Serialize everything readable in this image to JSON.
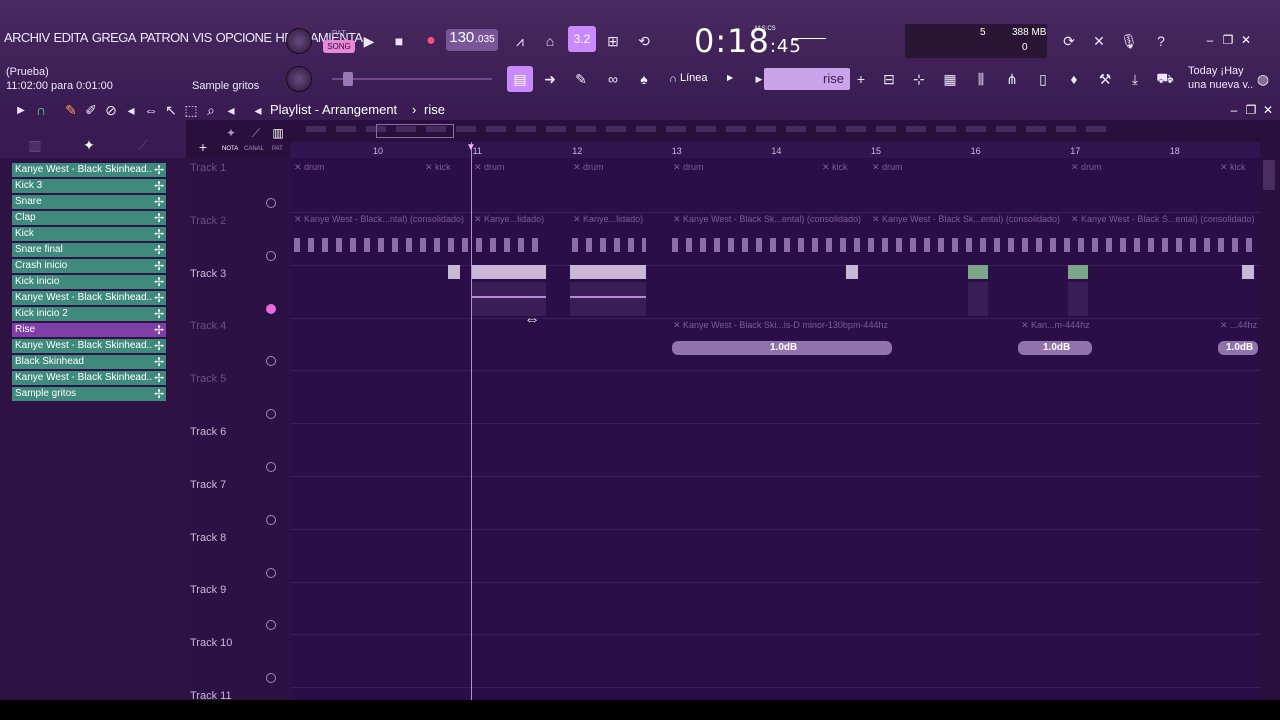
{
  "menu": [
    "ARCHIV",
    "EDITA",
    "GREGA",
    "PATRON",
    "VIS",
    "OPCIONE",
    "HERRAMIENTA"
  ],
  "hint": {
    "title": "(Prueba)",
    "line": "11:02:00 para 0:01:00",
    "sample": "Sample gritos"
  },
  "transport": {
    "pat": "PAT",
    "song": "SONG",
    "tempo_main": "130",
    "tempo_frac": ".035",
    "time_main": "0:18",
    "time_cs": ":45",
    "time_unit": "M:S:CS",
    "step": "3.2"
  },
  "monitor": {
    "mb": "388 MB",
    "cpu": "5",
    "poly": "0"
  },
  "snap_mode": "Línea",
  "pattern_selector": "rise",
  "news": {
    "line1": "Today  ¡Hay",
    "line2": "una nueva v.."
  },
  "playlist": {
    "title": "Playlist - Arrangement",
    "arrow": "›",
    "pattern": "rise"
  },
  "picker_tabs": [
    "NOTA",
    "CANAL",
    "PAT"
  ],
  "picker_items": [
    {
      "label": "Kanye West - Black Skinhead..",
      "kind": "audio"
    },
    {
      "label": "Kick 3",
      "kind": "audio"
    },
    {
      "label": "Snare",
      "kind": "audio"
    },
    {
      "label": "Clap",
      "kind": "audio"
    },
    {
      "label": "Kick",
      "kind": "audio"
    },
    {
      "label": "Snare final",
      "kind": "audio"
    },
    {
      "label": "Crash inicio",
      "kind": "audio"
    },
    {
      "label": "Kick inicio",
      "kind": "audio"
    },
    {
      "label": "Kanye West - Black Skinhead..",
      "kind": "audio"
    },
    {
      "label": "Kick inicio 2",
      "kind": "audio"
    },
    {
      "label": "Rise",
      "kind": "pattern"
    },
    {
      "label": "Kanye West - Black Skinhead..",
      "kind": "audio"
    },
    {
      "label": "Black Skinhead",
      "kind": "audio"
    },
    {
      "label": "Kanye West - Black Skinhead..",
      "kind": "audio"
    },
    {
      "label": "Sample gritos",
      "kind": "audio"
    }
  ],
  "tracks": [
    "Track 1",
    "Track 2",
    "Track 3",
    "Track 4",
    "Track 5",
    "Track 6",
    "Track 7",
    "Track 8",
    "Track 9",
    "Track 10",
    "Track 11"
  ],
  "ruler": [
    "10",
    "11",
    "12",
    "13",
    "14",
    "15",
    "16",
    "17",
    "18"
  ],
  "clips": {
    "t1": [
      "drum",
      "kick",
      "drum",
      "drum",
      "drum",
      "kick",
      "drum",
      "drum",
      "kick"
    ],
    "t2": [
      "Kanye West - Black...ntal) (consolidado)",
      "Kanye...lidado)",
      "Kanye...lidado)",
      "Kanye West - Black Sk...ental) (consolidado)",
      "Kanye West - Black Sk...ental) (consolidado)",
      "Kanye West - Black S...ental) (consolidado)"
    ],
    "t4": [
      "Kanye West - Black Ski...ls-D minor-130bpm-444hz",
      "Kan...m-444hz",
      "...44hz"
    ],
    "gain": "1.0dB"
  }
}
